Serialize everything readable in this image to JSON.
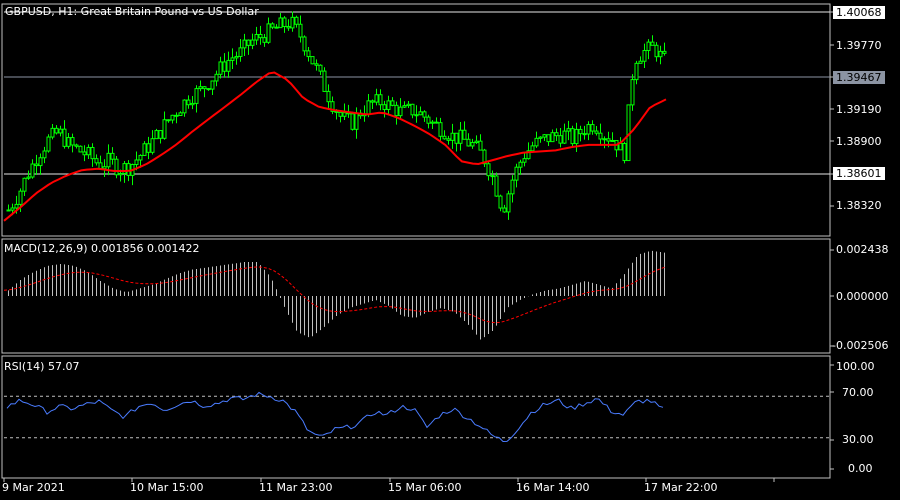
{
  "chart_title": "GBPUSD, H1:  Great Britain Pound vs US Dollar",
  "main_axis": {
    "ticks": [
      "1.40068",
      "1.39770",
      "1.39467",
      "1.39190",
      "1.38900",
      "1.38601",
      "1.38320"
    ],
    "highlight_labels": {
      "top_level": "1.40068",
      "current_price": "1.39467",
      "bottom_level": "1.38601"
    }
  },
  "macd": {
    "label": "MACD(12,26,9) 0.001856 0.001422",
    "ticks": [
      "0.002438",
      "0.000000",
      "-0.002506"
    ]
  },
  "rsi": {
    "label": "RSI(14) 57.07",
    "ticks": [
      "100.00",
      "70.00",
      "30.00",
      "0.00"
    ]
  },
  "x_labels": [
    "9 Mar 2021",
    "10 Mar 15:00",
    "11 Mar 23:00",
    "15 Mar 06:00",
    "16 Mar 14:00",
    "17 Mar 22:00"
  ],
  "colors": {
    "background": "#000000",
    "candle": "#00ff00",
    "moving_average": "#ff0000",
    "macd_histogram": "#c0c0c0",
    "macd_signal": "#ff0000",
    "rsi_line": "#4a7cff",
    "grid": "#c0c0c0"
  },
  "chart_data": [
    {
      "type": "candlestick",
      "title": "GBPUSD, H1:  Great Britain Pound vs US Dollar",
      "ylim": [
        1.3806,
        1.402
      ],
      "close_approx": [
        1.383,
        1.3845,
        1.3865,
        1.3882,
        1.3895,
        1.3902,
        1.389,
        1.3885,
        1.388,
        1.3872,
        1.3875,
        1.3868,
        1.387,
        1.388,
        1.389,
        1.3902,
        1.3915,
        1.3925,
        1.3935,
        1.394,
        1.395,
        1.396,
        1.397,
        1.3975,
        1.3985,
        1.399,
        1.3995,
        1.4,
        1.4003,
        1.399,
        1.397,
        1.395,
        1.393,
        1.3915,
        1.391,
        1.3922,
        1.3928,
        1.393,
        1.3925,
        1.392,
        1.3922,
        1.3918,
        1.391,
        1.3905,
        1.3898,
        1.3895,
        1.389,
        1.388,
        1.386,
        1.383,
        1.386,
        1.388,
        1.389,
        1.3895,
        1.3898,
        1.39,
        1.3895,
        1.3905,
        1.391,
        1.39,
        1.3895,
        1.388,
        1.397,
        1.3976,
        1.398,
        1.3967
      ],
      "moving_average_approx": [
        1.382,
        1.3832,
        1.3845,
        1.3855,
        1.3862,
        1.3867,
        1.3868,
        1.3866,
        1.3866,
        1.3872,
        1.3881,
        1.3891,
        1.3903,
        1.3914,
        1.3925,
        1.3936,
        1.3948,
        1.3958,
        1.395,
        1.3933,
        1.3925,
        1.3922,
        1.392,
        1.3918,
        1.392,
        1.3915,
        1.3908,
        1.39,
        1.389,
        1.3875,
        1.3872,
        1.3876,
        1.388,
        1.3883,
        1.3884,
        1.3885,
        1.3888,
        1.389,
        1.389,
        1.389,
        1.3905,
        1.3925,
        1.3932
      ]
    },
    {
      "type": "bar",
      "title": "MACD(12,26,9) 0.001856 0.001422",
      "ylim": [
        -0.002506,
        0.002438
      ],
      "values_approx": [
        0.0003,
        0.0009,
        0.0013,
        0.0016,
        0.0017,
        0.0016,
        0.0013,
        0.0008,
        0.0004,
        0.0002,
        0.0004,
        0.0006,
        0.0009,
        0.0012,
        0.0014,
        0.0015,
        0.0016,
        0.0017,
        0.0018,
        0.0018,
        0.001,
        -0.0005,
        -0.0018,
        -0.0021,
        -0.0016,
        -0.001,
        -0.0006,
        -0.0004,
        -0.0002,
        -0.0005,
        -0.001,
        -0.0011,
        -0.0008,
        -0.0006,
        -0.0008,
        -0.0014,
        -0.0022,
        -0.0017,
        -0.0006,
        -0.0002,
        0.0001,
        0.0003,
        0.0004,
        0.0006,
        0.0008,
        0.0006,
        0.0004,
        0.0012,
        0.0022,
        0.0024,
        0.0023
      ]
    },
    {
      "type": "line",
      "title": "RSI(14) 57.07",
      "ylim": [
        0,
        100
      ],
      "reference_levels": [
        70,
        30
      ],
      "values_approx": [
        60,
        66,
        62,
        55,
        60,
        58,
        62,
        65,
        56,
        50,
        60,
        64,
        57,
        62,
        66,
        61,
        63,
        68,
        67,
        72,
        70,
        66,
        55,
        36,
        30,
        38,
        40,
        45,
        55,
        52,
        60,
        58,
        40,
        52,
        58,
        50,
        42,
        32,
        26,
        40,
        55,
        62,
        66,
        58,
        63,
        68,
        56,
        52,
        65,
        66,
        57
      ]
    }
  ]
}
